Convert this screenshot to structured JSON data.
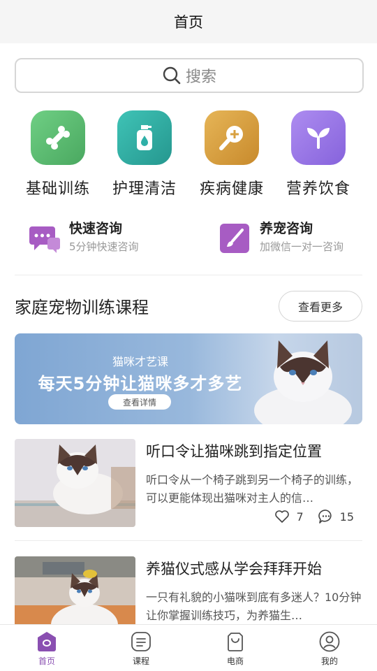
{
  "header": {
    "title": "首页"
  },
  "search": {
    "placeholder": "搜索"
  },
  "categories": [
    {
      "label": "基础训练",
      "icon": "bone-icon",
      "color": "#5bb873"
    },
    {
      "label": "护理清洁",
      "icon": "bottle-icon",
      "color": "#2fb0a8"
    },
    {
      "label": "疾病健康",
      "icon": "magnifier-plus-icon",
      "color": "#d8a040"
    },
    {
      "label": "营养饮食",
      "icon": "sprout-icon",
      "color": "#9b7ae6"
    }
  ],
  "consults": [
    {
      "title": "快速咨询",
      "subtitle": "5分钟快速咨询",
      "icon": "chat-bubble-icon",
      "color": "#a75cc3"
    },
    {
      "title": "养宠咨询",
      "subtitle": "加微信一对一咨询",
      "icon": "brush-icon",
      "color": "#a75cc3"
    }
  ],
  "section": {
    "title": "家庭宠物训练课程",
    "more_label": "查看更多"
  },
  "banner": {
    "subtitle": "猫咪才艺课",
    "title": "每天5分钟让猫咪多才多艺",
    "button_label": "查看详情"
  },
  "courses": [
    {
      "title": "听口令让猫咪跳到指定位置",
      "description": "听口令从一个椅子跳到另一个椅子的训练，可以更能体现出猫咪对主人的信…",
      "likes": "7",
      "comments": "15"
    },
    {
      "title": "养猫仪式感从学会拜拜开始",
      "description": "一只有礼貌的小猫咪到底有多迷人？10分钟让你掌握训练技巧，为养猫生…"
    }
  ],
  "tabs": [
    {
      "label": "首页",
      "icon": "home-icon",
      "active": true
    },
    {
      "label": "课程",
      "icon": "list-icon"
    },
    {
      "label": "电商",
      "icon": "shopping-bag-icon"
    },
    {
      "label": "我的",
      "icon": "user-icon"
    }
  ],
  "colors": {
    "accent": "#8a4fb1",
    "inactive": "#555555"
  }
}
